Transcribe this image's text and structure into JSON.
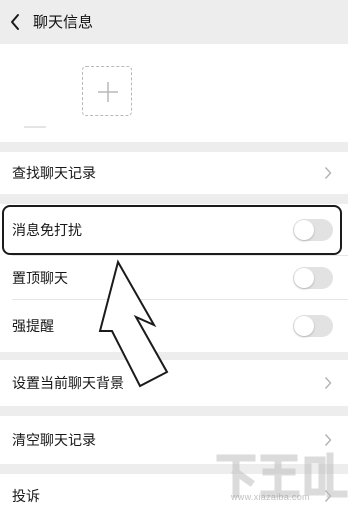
{
  "nav": {
    "title": "聊天信息"
  },
  "rows": {
    "search_history": "查找聊天记录",
    "mute_notifications": "消息免打扰",
    "sticky_on_top": "置顶聊天",
    "strong_alert": "强提醒",
    "set_background": "设置当前聊天背景",
    "clear_history": "清空聊天记录",
    "complain": "投诉"
  },
  "toggles": {
    "mute_notifications": false,
    "sticky_on_top": false,
    "strong_alert": false
  },
  "watermark": {
    "text": "www.xiazaiba.com"
  },
  "colors": {
    "background": "#ededed",
    "panel": "#ffffff",
    "toggle_off": "#e2e2e2",
    "annotation": "#1b1b1b"
  }
}
